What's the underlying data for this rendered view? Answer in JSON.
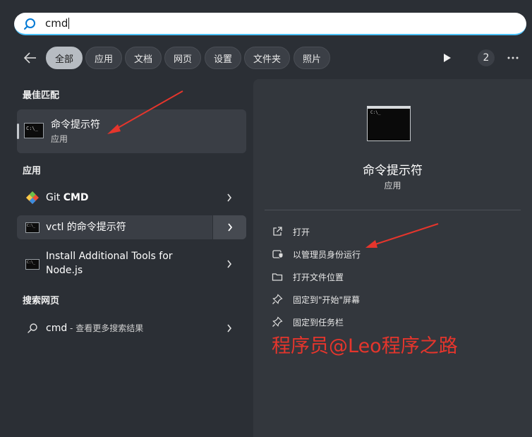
{
  "search": {
    "value": "cmd"
  },
  "filters": {
    "chips": [
      "全部",
      "应用",
      "文档",
      "网页",
      "设置",
      "文件夹",
      "照片"
    ],
    "active_index": 0,
    "badge_count": "2"
  },
  "best_match": {
    "heading": "最佳匹配",
    "title": "命令提示符",
    "subtitle": "应用",
    "icon_text": "C:\\_"
  },
  "apps": {
    "heading": "应用",
    "items": [
      {
        "label_plain": "Git ",
        "label_bold": "CMD"
      },
      {
        "label": "vctl 的命令提示符"
      },
      {
        "label_line1": "Install Additional Tools for",
        "label_line2": "Node.js"
      }
    ]
  },
  "web": {
    "heading": "搜索网页",
    "query": "cmd",
    "suffix": " - 查看更多搜索结果"
  },
  "detail": {
    "title": "命令提示符",
    "subtitle": "应用",
    "actions": [
      "打开",
      "以管理员身份运行",
      "打开文件位置",
      "固定到\"开始\"屏幕",
      "固定到任务栏"
    ]
  },
  "watermark": "程序员@Leo程序之路",
  "colors": {
    "background": "#2b2f35",
    "panel": "#33373d",
    "accent_search": "#4cc2ff",
    "annotation_red": "#e5352c"
  }
}
